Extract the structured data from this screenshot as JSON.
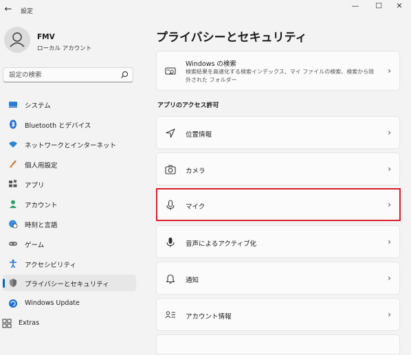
{
  "window": {
    "app_title": "設定",
    "back_glyph": "←",
    "minimize_glyph": "—",
    "maximize_glyph": "☐",
    "close_glyph": "✕"
  },
  "user": {
    "name": "FMV",
    "account_type": "ローカル アカウント"
  },
  "search": {
    "placeholder": "設定の検索"
  },
  "sidebar": {
    "items": [
      {
        "label": "システム",
        "icon": "display-icon"
      },
      {
        "label": "Bluetooth とデバイス",
        "icon": "bluetooth-icon"
      },
      {
        "label": "ネットワークとインターネット",
        "icon": "wifi-icon"
      },
      {
        "label": "個人用設定",
        "icon": "brush-icon"
      },
      {
        "label": "アプリ",
        "icon": "apps-icon"
      },
      {
        "label": "アカウント",
        "icon": "person-icon"
      },
      {
        "label": "時刻と言語",
        "icon": "globe-clock-icon"
      },
      {
        "label": "ゲーム",
        "icon": "gamepad-icon"
      },
      {
        "label": "アクセシビリティ",
        "icon": "accessibility-icon"
      },
      {
        "label": "プライバシーとセキュリティ",
        "icon": "shield-icon",
        "selected": true
      },
      {
        "label": "Windows Update",
        "icon": "update-icon"
      },
      {
        "label": "Extras",
        "icon": "extras-icon"
      }
    ]
  },
  "main": {
    "title": "プライバシーとセキュリティ",
    "windows_search": {
      "title": "Windows の検索",
      "description": "検索結果を高速化する検索インデックス、マイ ファイルの検索、検索から除外された フォルダー"
    },
    "section_label": "アプリのアクセス許可",
    "items": [
      {
        "label": "位置情報",
        "icon": "location-icon"
      },
      {
        "label": "カメラ",
        "icon": "camera-icon"
      },
      {
        "label": "マイク",
        "icon": "microphone-icon",
        "highlighted": true
      },
      {
        "label": "音声によるアクティブ化",
        "icon": "voice-activation-icon"
      },
      {
        "label": "通知",
        "icon": "bell-icon"
      },
      {
        "label": "アカウント情報",
        "icon": "account-info-icon"
      }
    ],
    "chevron": "›"
  },
  "colors": {
    "accent": "#0067c0",
    "highlight_border": "#d91e28",
    "window_bg": "#f3f3f3",
    "card_bg": "#fbfbfb"
  }
}
